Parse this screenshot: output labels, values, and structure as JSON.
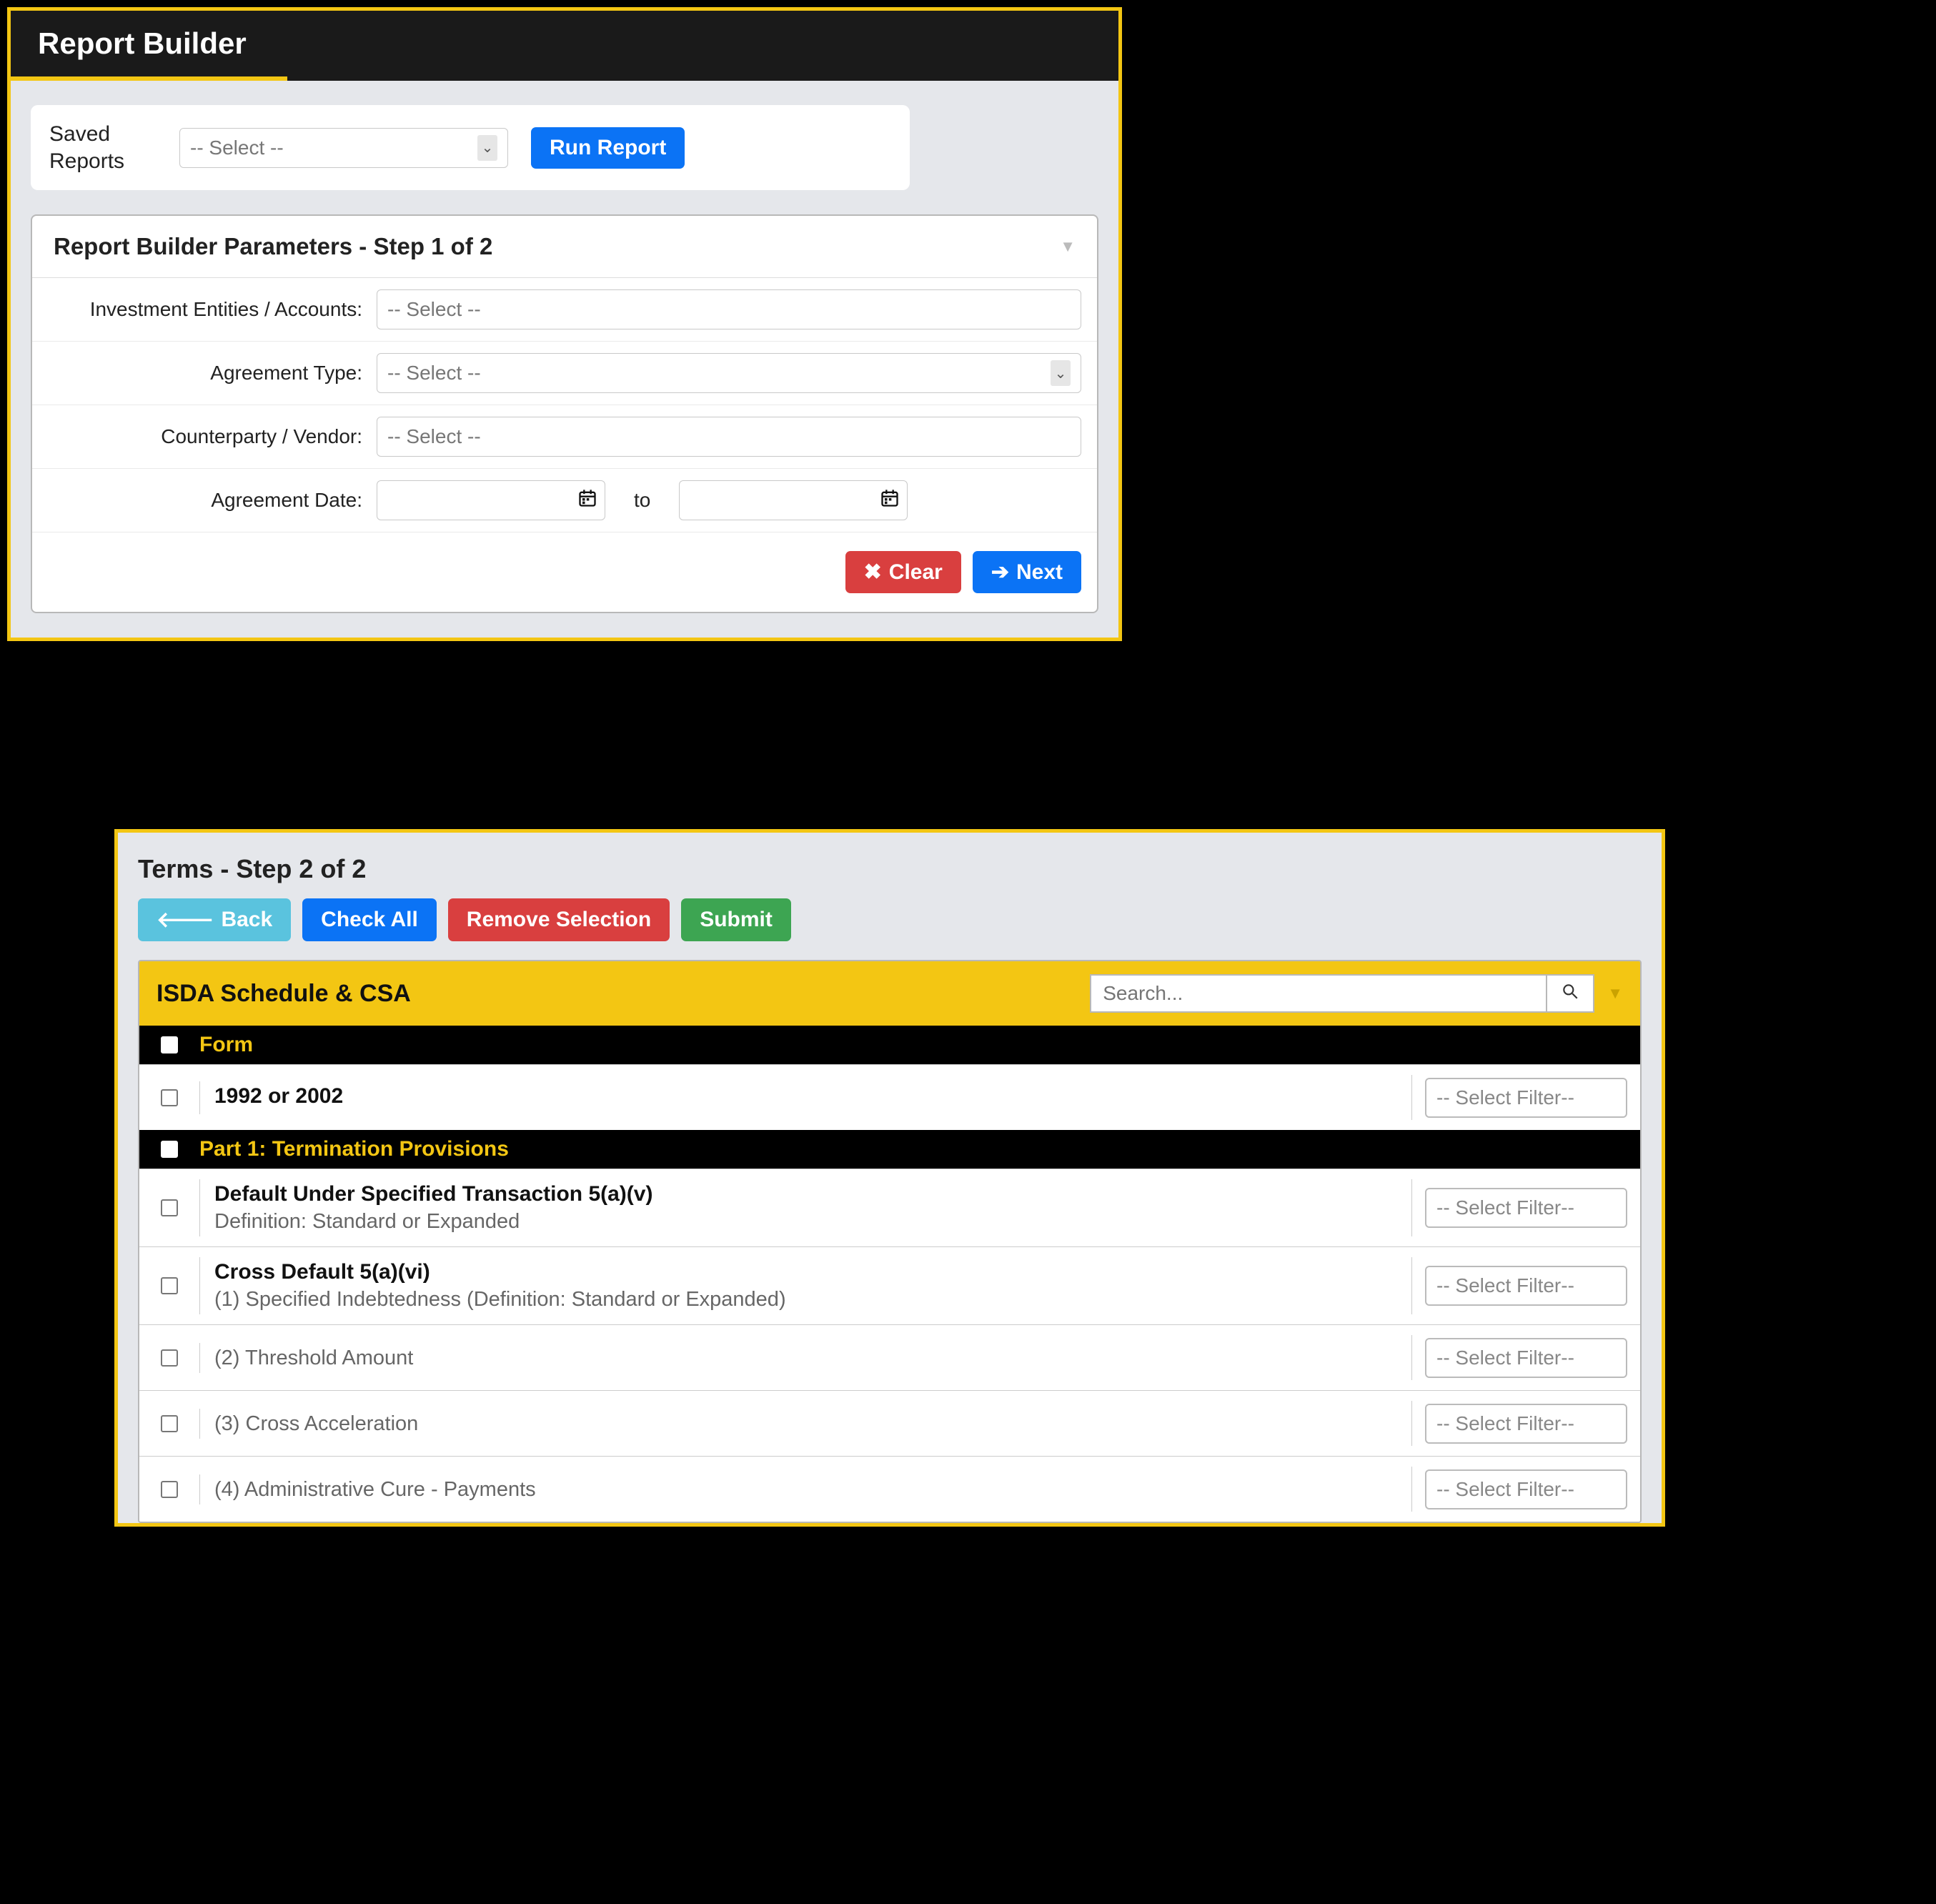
{
  "panel1": {
    "title": "Report Builder",
    "saved_label": "Saved Reports",
    "saved_placeholder": "-- Select --",
    "run_report": "Run Report",
    "params_title": "Report Builder Parameters - Step 1 of 2",
    "fields": {
      "entities_label": "Investment Entities / Accounts:",
      "agreement_type_label": "Agreement Type:",
      "counterparty_label": "Counterparty / Vendor:",
      "date_label": "Agreement Date:",
      "select_placeholder": "-- Select --",
      "to": "to"
    },
    "clear": "Clear",
    "next": "Next"
  },
  "panel2": {
    "title": "Terms - Step 2 of 2",
    "back": "Back",
    "check_all": "Check All",
    "remove": "Remove Selection",
    "submit": "Submit",
    "isda_title": "ISDA Schedule & CSA",
    "search_placeholder": "Search...",
    "filter_placeholder": "-- Select Filter--",
    "sections": [
      {
        "title": "Form",
        "rows": [
          {
            "bold": "1992 or 2002",
            "sub": "",
            "filter": true
          }
        ]
      },
      {
        "title": "Part 1: Termination Provisions",
        "rows": [
          {
            "bold": "Default Under Specified Transaction 5(a)(v)",
            "sub": "Definition: Standard or Expanded",
            "filter": true
          },
          {
            "bold": "Cross Default 5(a)(vi)",
            "sub": "(1) Specified Indebtedness (Definition: Standard or Expanded)",
            "filter": true
          },
          {
            "bold": "",
            "sub": "(2) Threshold Amount",
            "filter": true
          },
          {
            "bold": "",
            "sub": "(3) Cross Acceleration",
            "filter": true
          },
          {
            "bold": "",
            "sub": "(4) Administrative Cure - Payments",
            "filter": true
          }
        ]
      }
    ]
  }
}
